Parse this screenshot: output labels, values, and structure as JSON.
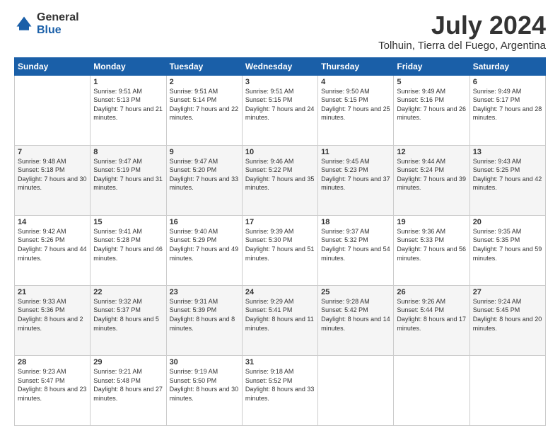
{
  "logo": {
    "general": "General",
    "blue": "Blue"
  },
  "title": "July 2024",
  "subtitle": "Tolhuin, Tierra del Fuego, Argentina",
  "days_of_week": [
    "Sunday",
    "Monday",
    "Tuesday",
    "Wednesday",
    "Thursday",
    "Friday",
    "Saturday"
  ],
  "weeks": [
    [
      {
        "day": "",
        "sunrise": "",
        "sunset": "",
        "daylight": ""
      },
      {
        "day": "1",
        "sunrise": "Sunrise: 9:51 AM",
        "sunset": "Sunset: 5:13 PM",
        "daylight": "Daylight: 7 hours and 21 minutes."
      },
      {
        "day": "2",
        "sunrise": "Sunrise: 9:51 AM",
        "sunset": "Sunset: 5:14 PM",
        "daylight": "Daylight: 7 hours and 22 minutes."
      },
      {
        "day": "3",
        "sunrise": "Sunrise: 9:51 AM",
        "sunset": "Sunset: 5:15 PM",
        "daylight": "Daylight: 7 hours and 24 minutes."
      },
      {
        "day": "4",
        "sunrise": "Sunrise: 9:50 AM",
        "sunset": "Sunset: 5:15 PM",
        "daylight": "Daylight: 7 hours and 25 minutes."
      },
      {
        "day": "5",
        "sunrise": "Sunrise: 9:49 AM",
        "sunset": "Sunset: 5:16 PM",
        "daylight": "Daylight: 7 hours and 26 minutes."
      },
      {
        "day": "6",
        "sunrise": "Sunrise: 9:49 AM",
        "sunset": "Sunset: 5:17 PM",
        "daylight": "Daylight: 7 hours and 28 minutes."
      }
    ],
    [
      {
        "day": "7",
        "sunrise": "Sunrise: 9:48 AM",
        "sunset": "Sunset: 5:18 PM",
        "daylight": "Daylight: 7 hours and 30 minutes."
      },
      {
        "day": "8",
        "sunrise": "Sunrise: 9:47 AM",
        "sunset": "Sunset: 5:19 PM",
        "daylight": "Daylight: 7 hours and 31 minutes."
      },
      {
        "day": "9",
        "sunrise": "Sunrise: 9:47 AM",
        "sunset": "Sunset: 5:20 PM",
        "daylight": "Daylight: 7 hours and 33 minutes."
      },
      {
        "day": "10",
        "sunrise": "Sunrise: 9:46 AM",
        "sunset": "Sunset: 5:22 PM",
        "daylight": "Daylight: 7 hours and 35 minutes."
      },
      {
        "day": "11",
        "sunrise": "Sunrise: 9:45 AM",
        "sunset": "Sunset: 5:23 PM",
        "daylight": "Daylight: 7 hours and 37 minutes."
      },
      {
        "day": "12",
        "sunrise": "Sunrise: 9:44 AM",
        "sunset": "Sunset: 5:24 PM",
        "daylight": "Daylight: 7 hours and 39 minutes."
      },
      {
        "day": "13",
        "sunrise": "Sunrise: 9:43 AM",
        "sunset": "Sunset: 5:25 PM",
        "daylight": "Daylight: 7 hours and 42 minutes."
      }
    ],
    [
      {
        "day": "14",
        "sunrise": "Sunrise: 9:42 AM",
        "sunset": "Sunset: 5:26 PM",
        "daylight": "Daylight: 7 hours and 44 minutes."
      },
      {
        "day": "15",
        "sunrise": "Sunrise: 9:41 AM",
        "sunset": "Sunset: 5:28 PM",
        "daylight": "Daylight: 7 hours and 46 minutes."
      },
      {
        "day": "16",
        "sunrise": "Sunrise: 9:40 AM",
        "sunset": "Sunset: 5:29 PM",
        "daylight": "Daylight: 7 hours and 49 minutes."
      },
      {
        "day": "17",
        "sunrise": "Sunrise: 9:39 AM",
        "sunset": "Sunset: 5:30 PM",
        "daylight": "Daylight: 7 hours and 51 minutes."
      },
      {
        "day": "18",
        "sunrise": "Sunrise: 9:37 AM",
        "sunset": "Sunset: 5:32 PM",
        "daylight": "Daylight: 7 hours and 54 minutes."
      },
      {
        "day": "19",
        "sunrise": "Sunrise: 9:36 AM",
        "sunset": "Sunset: 5:33 PM",
        "daylight": "Daylight: 7 hours and 56 minutes."
      },
      {
        "day": "20",
        "sunrise": "Sunrise: 9:35 AM",
        "sunset": "Sunset: 5:35 PM",
        "daylight": "Daylight: 7 hours and 59 minutes."
      }
    ],
    [
      {
        "day": "21",
        "sunrise": "Sunrise: 9:33 AM",
        "sunset": "Sunset: 5:36 PM",
        "daylight": "Daylight: 8 hours and 2 minutes."
      },
      {
        "day": "22",
        "sunrise": "Sunrise: 9:32 AM",
        "sunset": "Sunset: 5:37 PM",
        "daylight": "Daylight: 8 hours and 5 minutes."
      },
      {
        "day": "23",
        "sunrise": "Sunrise: 9:31 AM",
        "sunset": "Sunset: 5:39 PM",
        "daylight": "Daylight: 8 hours and 8 minutes."
      },
      {
        "day": "24",
        "sunrise": "Sunrise: 9:29 AM",
        "sunset": "Sunset: 5:41 PM",
        "daylight": "Daylight: 8 hours and 11 minutes."
      },
      {
        "day": "25",
        "sunrise": "Sunrise: 9:28 AM",
        "sunset": "Sunset: 5:42 PM",
        "daylight": "Daylight: 8 hours and 14 minutes."
      },
      {
        "day": "26",
        "sunrise": "Sunrise: 9:26 AM",
        "sunset": "Sunset: 5:44 PM",
        "daylight": "Daylight: 8 hours and 17 minutes."
      },
      {
        "day": "27",
        "sunrise": "Sunrise: 9:24 AM",
        "sunset": "Sunset: 5:45 PM",
        "daylight": "Daylight: 8 hours and 20 minutes."
      }
    ],
    [
      {
        "day": "28",
        "sunrise": "Sunrise: 9:23 AM",
        "sunset": "Sunset: 5:47 PM",
        "daylight": "Daylight: 8 hours and 23 minutes."
      },
      {
        "day": "29",
        "sunrise": "Sunrise: 9:21 AM",
        "sunset": "Sunset: 5:48 PM",
        "daylight": "Daylight: 8 hours and 27 minutes."
      },
      {
        "day": "30",
        "sunrise": "Sunrise: 9:19 AM",
        "sunset": "Sunset: 5:50 PM",
        "daylight": "Daylight: 8 hours and 30 minutes."
      },
      {
        "day": "31",
        "sunrise": "Sunrise: 9:18 AM",
        "sunset": "Sunset: 5:52 PM",
        "daylight": "Daylight: 8 hours and 33 minutes."
      },
      {
        "day": "",
        "sunrise": "",
        "sunset": "",
        "daylight": ""
      },
      {
        "day": "",
        "sunrise": "",
        "sunset": "",
        "daylight": ""
      },
      {
        "day": "",
        "sunrise": "",
        "sunset": "",
        "daylight": ""
      }
    ]
  ]
}
